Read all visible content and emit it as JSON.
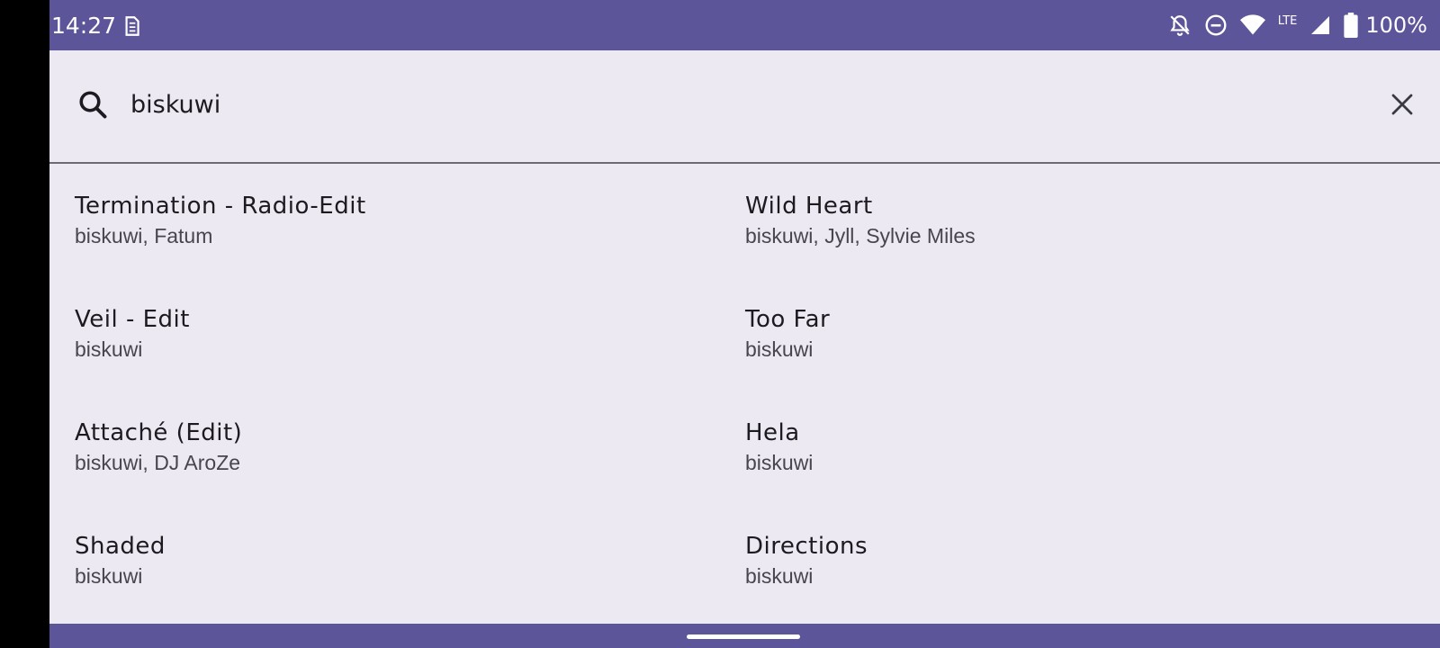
{
  "status_bar": {
    "time": "14:27",
    "network_label": "LTE",
    "battery_percent": "100%",
    "icons": [
      "sim-icon",
      "notifications-off-icon",
      "do-not-disturb-icon",
      "wifi-icon",
      "lte-icon",
      "signal-icon",
      "battery-icon"
    ]
  },
  "search": {
    "query": "biskuwi",
    "icon": "search-icon",
    "clear_icon": "close-icon"
  },
  "results": [
    {
      "title": "Termination - Radio-Edit",
      "artists": "biskuwi, Fatum"
    },
    {
      "title": "Wild Heart",
      "artists": "biskuwi, Jyll, Sylvie Miles"
    },
    {
      "title": "Veil - Edit",
      "artists": "biskuwi"
    },
    {
      "title": "Too Far",
      "artists": "biskuwi"
    },
    {
      "title": "Attaché (Edit)",
      "artists": "biskuwi, DJ AroZe"
    },
    {
      "title": "Hela",
      "artists": "biskuwi"
    },
    {
      "title": "Shaded",
      "artists": "biskuwi"
    },
    {
      "title": "Directions",
      "artists": "biskuwi"
    }
  ],
  "colors": {
    "system_bar": "#5C5599",
    "background": "#ECE9F3",
    "title_text": "#1C1B1F",
    "subtitle_text": "#49454F"
  }
}
